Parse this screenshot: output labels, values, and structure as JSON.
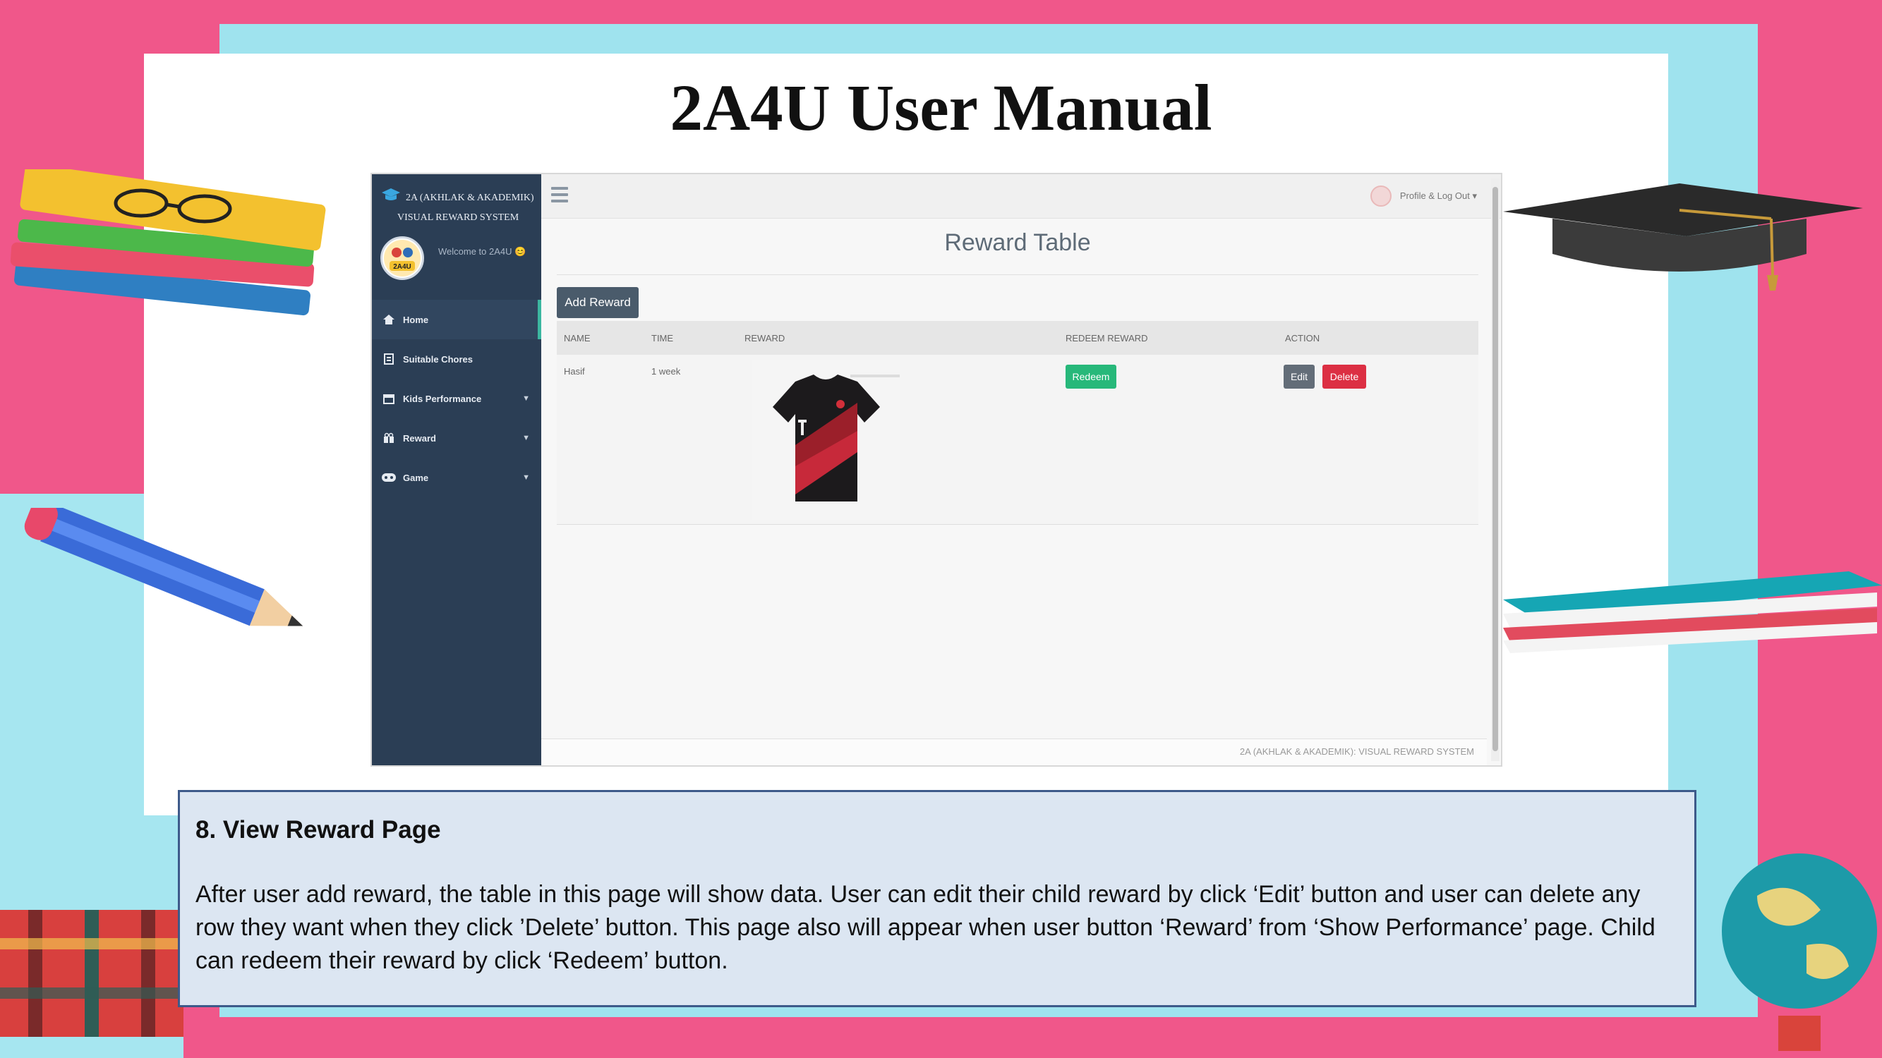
{
  "slide": {
    "title": "2A4U User Manual"
  },
  "app": {
    "brand_line1": "2A (AKHLAK & AKADEMIK)",
    "brand_line2": "VISUAL REWARD SYSTEM",
    "avatar_text": "2A4U",
    "welcome": "Welcome to 2A4U 😊",
    "nav": [
      {
        "label": "Home",
        "icon": "home-icon"
      },
      {
        "label": "Suitable Chores",
        "icon": "document-icon"
      },
      {
        "label": "Kids Performance",
        "icon": "calendar-icon"
      },
      {
        "label": "Reward",
        "icon": "gift-icon"
      },
      {
        "label": "Game",
        "icon": "gamepad-icon"
      }
    ],
    "profile_label": "Profile & Log Out ▾",
    "page_title": "Reward Table",
    "add_button": "Add Reward",
    "table": {
      "headers": [
        "NAME",
        "TIME",
        "REWARD",
        "REDEEM REWARD",
        "ACTION"
      ],
      "rows": [
        {
          "name": "Hasif",
          "time": "1 week",
          "redeem": "Redeem",
          "edit": "Edit",
          "delete": "Delete"
        }
      ]
    },
    "footer": "2A (AKHLAK & AKADEMIK): VISUAL REWARD SYSTEM",
    "colors": {
      "sidebar": "#2b3e55",
      "redeem": "#27b87a",
      "delete": "#dc2f43",
      "edit": "#636d78"
    }
  },
  "description": {
    "heading": "8. View Reward Page",
    "body": "After user add reward, the table in this page will show data. User can edit their child reward by click ‘Edit’ button and user can delete any row they want when they click ’Delete’ button. This page also will appear when user button ‘Reward’ from ‘Show Performance’ page. Child can redeem their reward by click ‘Redeem’ button."
  }
}
